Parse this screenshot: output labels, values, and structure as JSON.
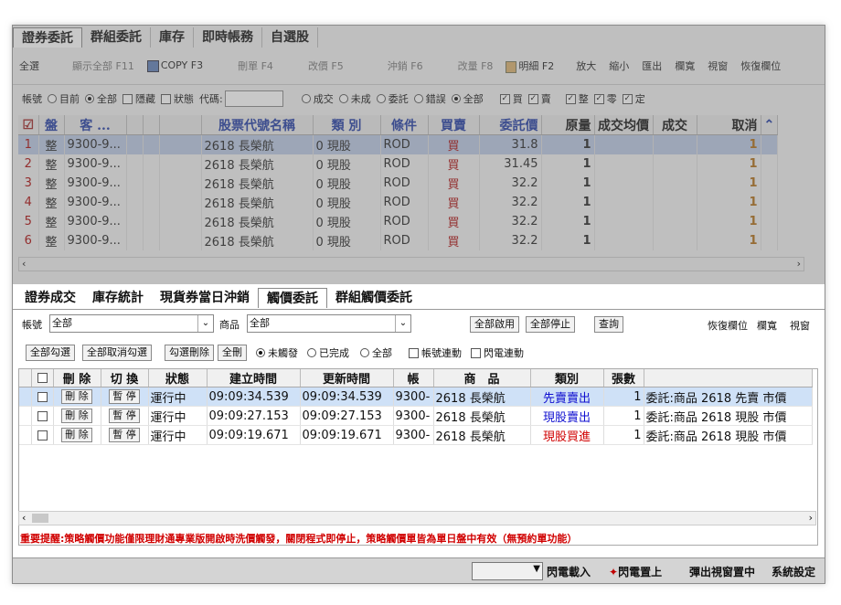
{
  "top_tabs": [
    "證券委託",
    "群組委託",
    "庫存",
    "即時帳務",
    "自選股"
  ],
  "toolbar": [
    "全選",
    "顯示全部 F11",
    "COPY F3",
    "刪單 F4",
    "改價 F5",
    "沖銷 F6",
    "改量 F8",
    "明細 F2",
    "放大",
    "縮小",
    "匯出",
    "欄寬",
    "視窗",
    "恢復欄位"
  ],
  "filter": {
    "acct_label": "帳號",
    "acct_options": [
      "目前",
      "全部"
    ],
    "hide": "隱藏",
    "status": "狀態",
    "code_label": "代碼:",
    "state_options": [
      "成交",
      "未成",
      "委託",
      "錯誤",
      "全部"
    ],
    "side": [
      "買",
      "賣"
    ],
    "lot": [
      "整",
      "零",
      "定"
    ]
  },
  "orders": {
    "headers": [
      "盤",
      "客 ...",
      "",
      "",
      "",
      "股票代號名稱",
      "類 別",
      "條件",
      "買賣",
      "委託價",
      "原量",
      "成交均價",
      "成交",
      "取消"
    ],
    "rows": [
      {
        "n": "1",
        "pan": "整",
        "cust": "9300-9...",
        "stock": "2618 長榮航",
        "kind": "0 現股",
        "cond": "ROD",
        "side": "買",
        "price": "31.8",
        "qty": "1",
        "cancel": "1"
      },
      {
        "n": "2",
        "pan": "整",
        "cust": "9300-9...",
        "stock": "2618 長榮航",
        "kind": "0 現股",
        "cond": "ROD",
        "side": "買",
        "price": "31.45",
        "qty": "1",
        "cancel": "1"
      },
      {
        "n": "3",
        "pan": "整",
        "cust": "9300-9...",
        "stock": "2618 長榮航",
        "kind": "0 現股",
        "cond": "ROD",
        "side": "買",
        "price": "32.2",
        "qty": "1",
        "cancel": "1"
      },
      {
        "n": "4",
        "pan": "整",
        "cust": "9300-9...",
        "stock": "2618 長榮航",
        "kind": "0 現股",
        "cond": "ROD",
        "side": "買",
        "price": "32.2",
        "qty": "1",
        "cancel": "1"
      },
      {
        "n": "5",
        "pan": "整",
        "cust": "9300-9...",
        "stock": "2618 長榮航",
        "kind": "0 現股",
        "cond": "ROD",
        "side": "買",
        "price": "32.2",
        "qty": "1",
        "cancel": "1"
      },
      {
        "n": "6",
        "pan": "整",
        "cust": "9300-9...",
        "stock": "2618 長榮航",
        "kind": "0 現股",
        "cond": "ROD",
        "side": "買",
        "price": "32.2",
        "qty": "1",
        "cancel": "1"
      }
    ]
  },
  "lower_tabs": [
    "證券成交",
    "庫存統計",
    "現貨券當日沖銷",
    "觸價委託",
    "群組觸價委託"
  ],
  "trigger": {
    "acct_label": "帳號",
    "acct_value": "全部",
    "product_label": "商品",
    "product_value": "全部",
    "btn_enable_all": "全部啟用",
    "btn_stop_all": "全部停止",
    "btn_query": "查詢",
    "right_links": [
      "恢復欄位",
      "欄寬",
      "視窗"
    ],
    "btn_check_all": "全部勾選",
    "btn_uncheck_all": "全部取消勾選",
    "btn_delete_checked": "勾選刪除",
    "btn_delete_all": "全刪",
    "radio": [
      "未觸發",
      "已完成",
      "全部"
    ],
    "chk_acct_link": "帳號連動",
    "chk_flash_link": "閃電連動",
    "headers": [
      "",
      "刪 除",
      "切 換",
      "狀態",
      "建立時間",
      "更新時間",
      "帳",
      "商　品",
      "類別",
      "張數",
      ""
    ],
    "rows": [
      {
        "del": "刪 除",
        "sw": "暫 停",
        "state": "運行中",
        "created": "09:09:34.539",
        "updated": "09:09:34.539",
        "acct": "9300-",
        "product": "2618 長榮航",
        "type": "先賣賣出",
        "type_color": "#1010d0",
        "qty": "1",
        "desc": "委託:商品 2618 先賣 市價"
      },
      {
        "del": "刪 除",
        "sw": "暫 停",
        "state": "運行中",
        "created": "09:09:27.153",
        "updated": "09:09:27.153",
        "acct": "9300-",
        "product": "2618 長榮航",
        "type": "現股賣出",
        "type_color": "#1010d0",
        "qty": "1",
        "desc": "委託:商品 2618 現股 市價"
      },
      {
        "del": "刪 除",
        "sw": "暫 停",
        "state": "運行中",
        "created": "09:09:19.671",
        "updated": "09:09:19.671",
        "acct": "9300-",
        "product": "2618 長榮航",
        "type": "現股買進",
        "type_color": "#d00000",
        "qty": "1",
        "desc": "委託:商品 2618 現股 市價"
      }
    ],
    "notice": "重要提醒:策略觸價功能僅限理財通專業版開啟時洗價觸發，關閉程式即停止，策略觸價單皆為單日盤中有效（無預約單功能）"
  },
  "status_bar": [
    "閃電載入",
    "閃電置上",
    "彈出視窗置中",
    "系統設定"
  ]
}
